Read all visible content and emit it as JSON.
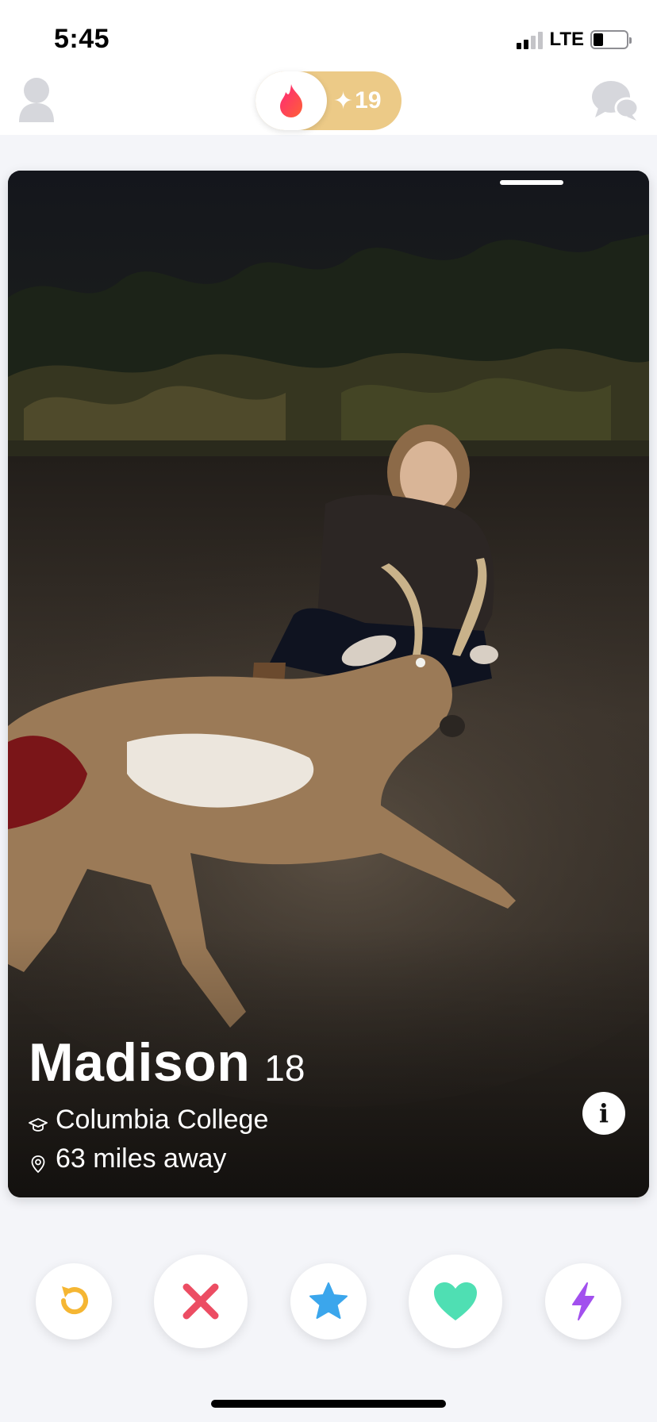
{
  "status_bar": {
    "time": "5:45",
    "network": "LTE",
    "signal_bars_active": 2,
    "battery_level": 0.3
  },
  "top_nav": {
    "profile_icon": "profile-icon",
    "messages_icon": "messages-icon",
    "toggle": {
      "left_icon": "flame-icon",
      "gold_count": "19",
      "gold_icon": "sparkle-icon"
    }
  },
  "card": {
    "name": "Madison",
    "age": "18",
    "school": "Columbia College",
    "distance": "63 miles away",
    "school_icon": "graduation-cap-icon",
    "distance_icon": "location-pin-icon",
    "info_label": "i",
    "photo_index": 1,
    "photo_count": 1
  },
  "actions": [
    {
      "name": "rewind",
      "icon": "rewind-icon",
      "color": "#f5b633"
    },
    {
      "name": "nope",
      "icon": "x-icon",
      "color": "#ec4d63"
    },
    {
      "name": "super-like",
      "icon": "star-icon",
      "color": "#3ba6ec"
    },
    {
      "name": "like",
      "icon": "heart-icon",
      "color": "#4fdfb3"
    },
    {
      "name": "boost",
      "icon": "lightning-icon",
      "color": "#a250ee"
    }
  ],
  "colors": {
    "brand": "#fe3c72",
    "gold": "#ecca87",
    "background": "#f4f5f9"
  }
}
